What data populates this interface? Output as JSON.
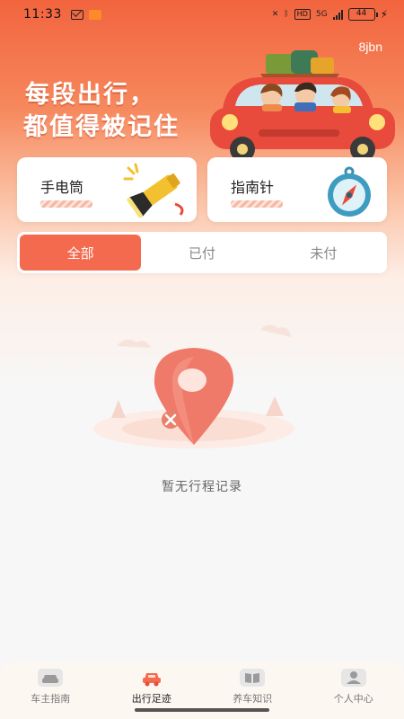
{
  "status_bar": {
    "time": "11:33",
    "network_label": "HD",
    "network_speed": "5G",
    "battery": "44"
  },
  "header": {
    "corner_tag": "8jbn",
    "slogan_line1": "每段出行，",
    "slogan_line2": "都值得被记住"
  },
  "tools": [
    {
      "label": "手电筒",
      "icon": "flashlight-icon"
    },
    {
      "label": "指南针",
      "icon": "compass-icon"
    }
  ],
  "tabs": [
    {
      "label": "全部",
      "active": true
    },
    {
      "label": "已付",
      "active": false
    },
    {
      "label": "未付",
      "active": false
    }
  ],
  "empty_state": {
    "message": "暂无行程记录",
    "icon": "location-pin-icon"
  },
  "bottom_nav": [
    {
      "label": "车主指南",
      "icon": "car-icon",
      "active": false
    },
    {
      "label": "出行足迹",
      "icon": "trip-car-icon",
      "active": true
    },
    {
      "label": "养车知识",
      "icon": "book-icon",
      "active": false
    },
    {
      "label": "个人中心",
      "icon": "user-icon",
      "active": false
    }
  ],
  "colors": {
    "accent": "#f46a4f",
    "header_gradient_top": "#f2643e"
  }
}
